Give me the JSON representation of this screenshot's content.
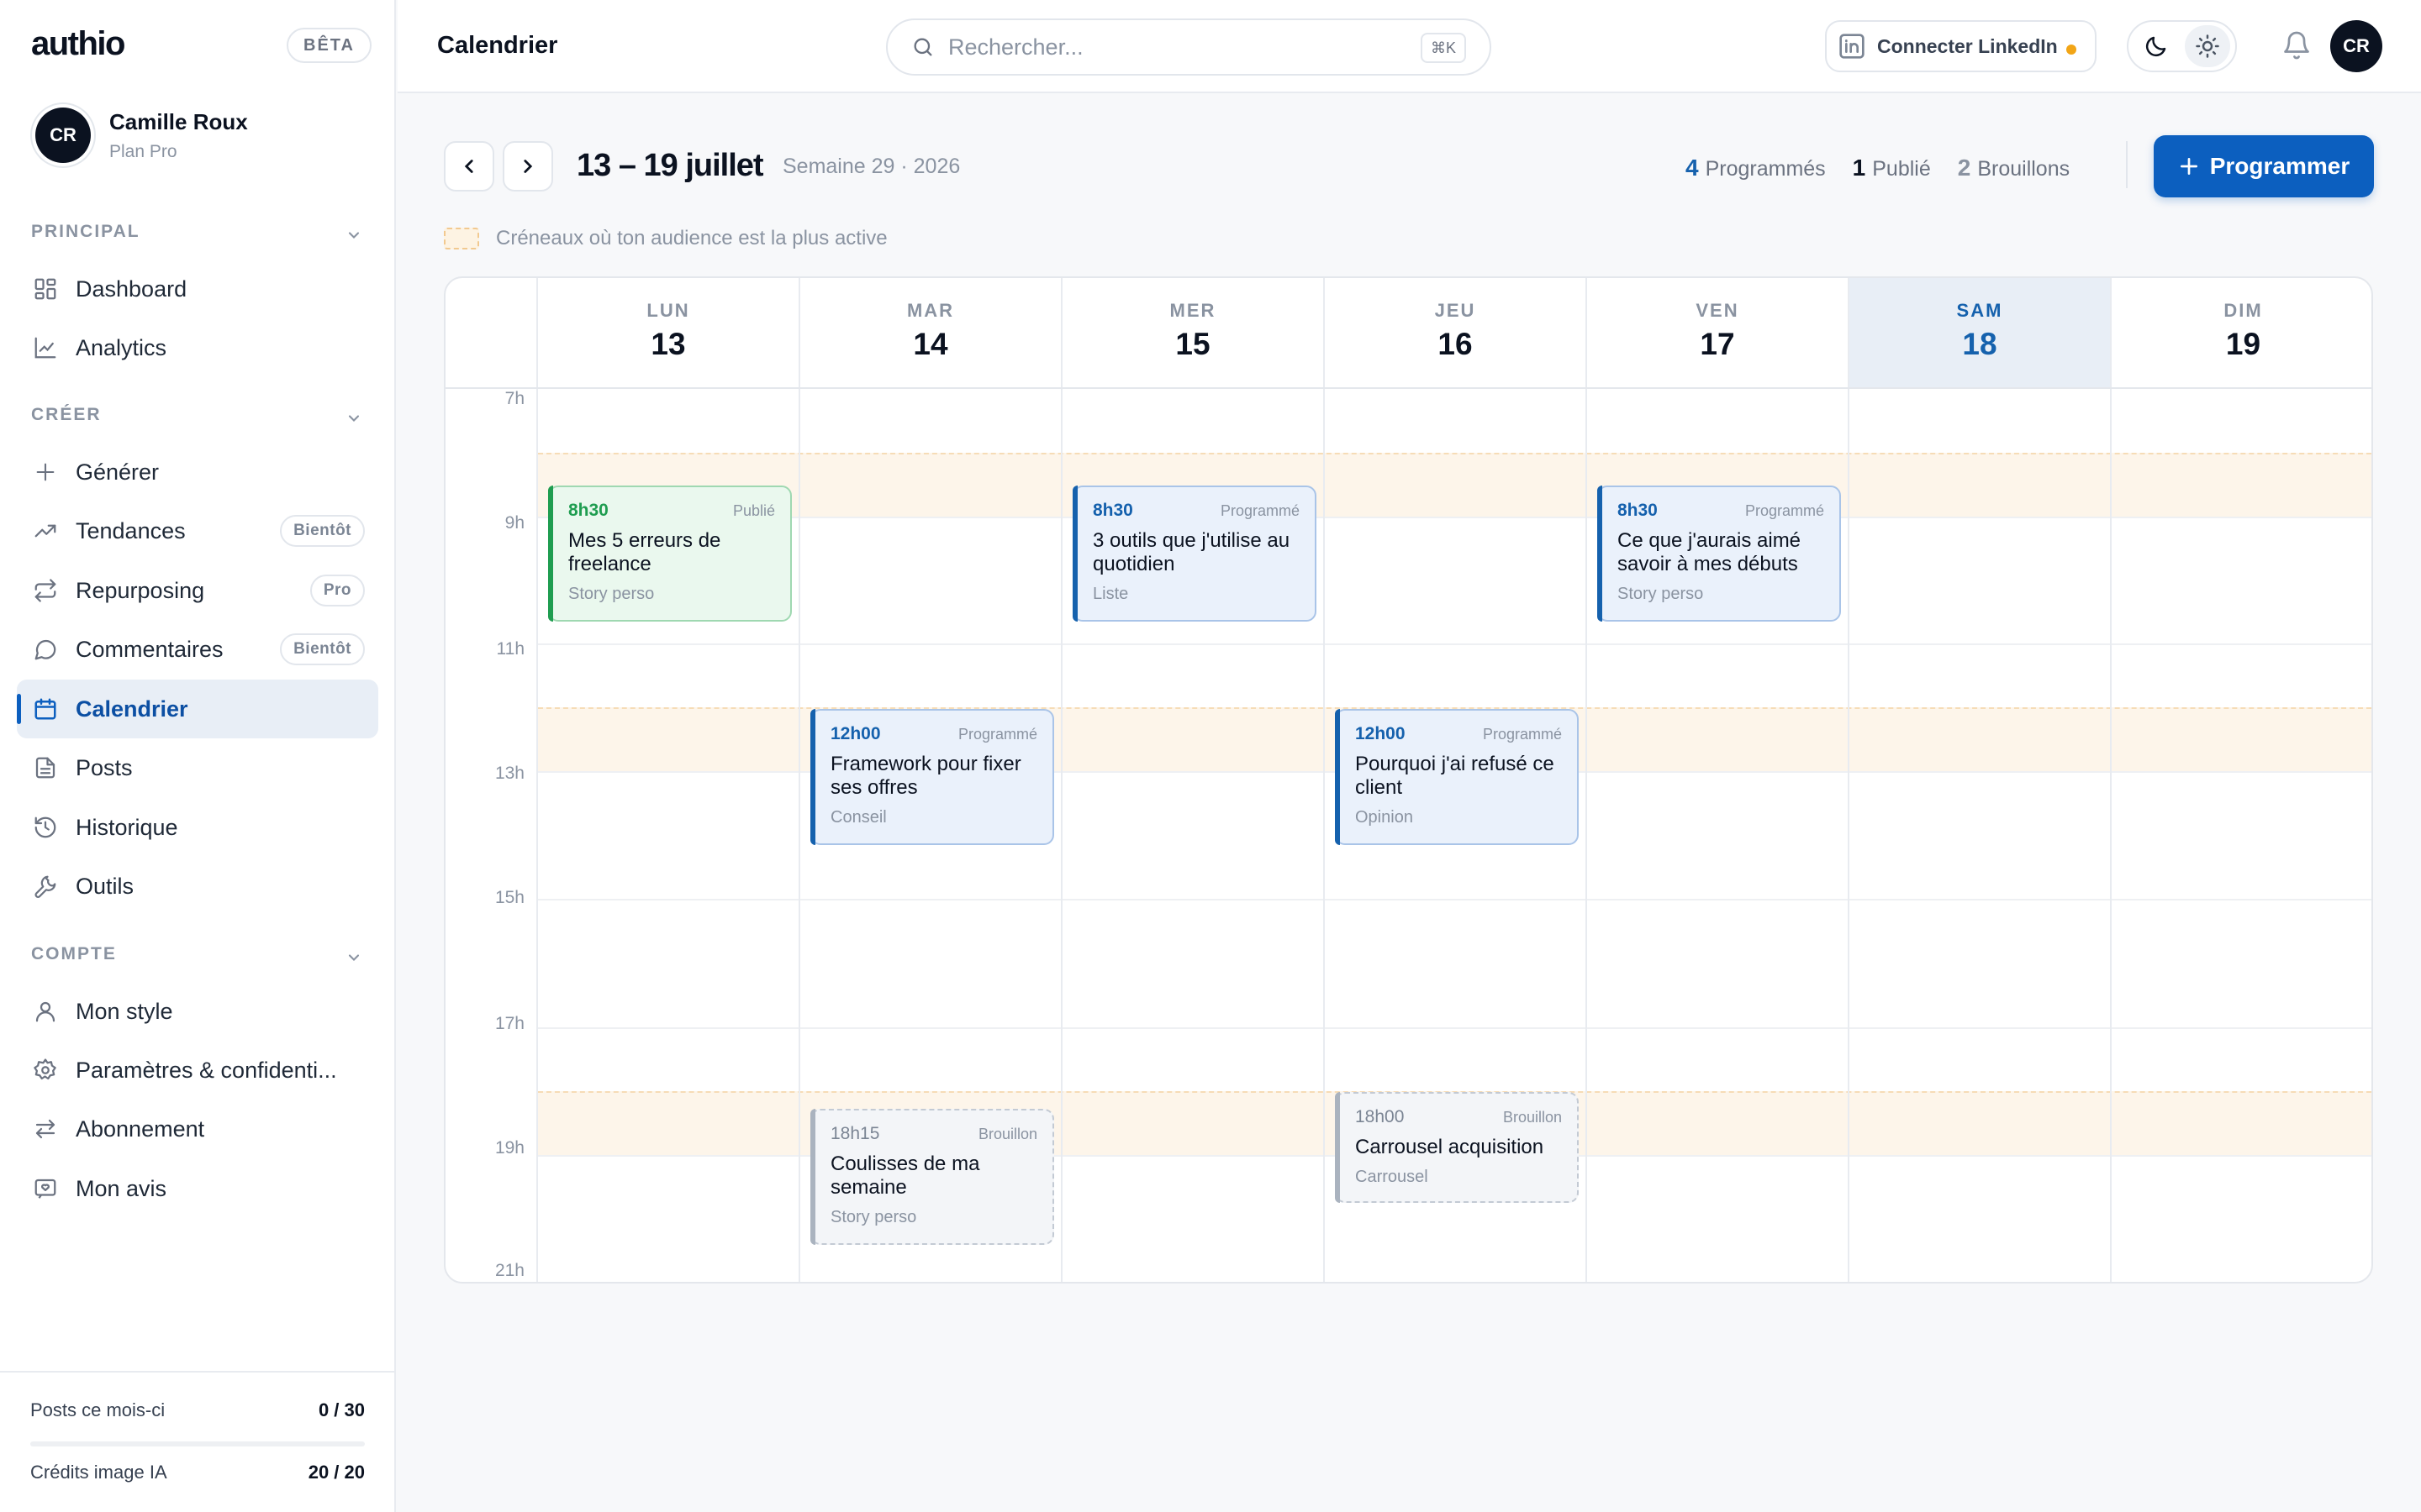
{
  "app": {
    "logo": "authio",
    "badge": "BÊTA"
  },
  "user": {
    "initials": "CR",
    "name": "Camille Roux",
    "plan": "Plan Pro"
  },
  "sidebar": {
    "sections": [
      {
        "title": "PRINCIPAL"
      },
      {
        "title": "CRÉER"
      },
      {
        "title": "COMPTE"
      }
    ],
    "items": [
      {
        "label": "Dashboard",
        "icon": "grid-icon"
      },
      {
        "label": "Analytics",
        "icon": "chart-icon"
      },
      {
        "label": "Générer",
        "icon": "plus-icon"
      },
      {
        "label": "Tendances",
        "icon": "trending-icon",
        "badge": "Bientôt"
      },
      {
        "label": "Repurposing",
        "icon": "repeat-icon",
        "badge": "Pro"
      },
      {
        "label": "Commentaires",
        "icon": "comment-icon",
        "badge": "Bientôt"
      },
      {
        "label": "Calendrier",
        "icon": "calendar-icon",
        "active": true
      },
      {
        "label": "Posts",
        "icon": "file-icon"
      },
      {
        "label": "Historique",
        "icon": "history-icon"
      },
      {
        "label": "Outils",
        "icon": "wrench-icon"
      },
      {
        "label": "Mon style",
        "icon": "user-icon"
      },
      {
        "label": "Paramètres & confidenti...",
        "icon": "gear-icon"
      },
      {
        "label": "Abonnement",
        "icon": "swap-icon"
      },
      {
        "label": "Mon avis",
        "icon": "feedback-icon"
      }
    ],
    "quotas": [
      {
        "label": "Posts ce mois-ci",
        "value": "0 / 30",
        "fill": 0
      },
      {
        "label": "Crédits image IA",
        "value": "20 / 20",
        "fill": 1
      }
    ]
  },
  "topbar": {
    "title": "Calendrier",
    "search_placeholder": "Rechercher...",
    "search_shortcut": "⌘K",
    "linkedin_label": "Connecter LinkedIn",
    "avatar_initials": "CR"
  },
  "calendar": {
    "range": "13 – 19 juillet",
    "week": "Semaine 29 · 2026",
    "stats": [
      {
        "count": "4",
        "label": "Programmés",
        "color": "#1561ad"
      },
      {
        "count": "1",
        "label": "Publié",
        "color": "#0b1220"
      },
      {
        "count": "2",
        "label": "Brouillons",
        "color": "#8a93a1"
      }
    ],
    "program_label": "Programmer",
    "legend": "Créneaux où ton audience est la plus active",
    "days": [
      {
        "name": "LUN",
        "date": "13"
      },
      {
        "name": "MAR",
        "date": "14"
      },
      {
        "name": "MER",
        "date": "15"
      },
      {
        "name": "JEU",
        "date": "16"
      },
      {
        "name": "VEN",
        "date": "17"
      },
      {
        "name": "SAM",
        "date": "18",
        "today": true
      },
      {
        "name": "DIM",
        "date": "19"
      }
    ],
    "hours": [
      "7h",
      "9h",
      "11h",
      "13h",
      "15h",
      "17h",
      "19h",
      "21h"
    ],
    "events": [
      {
        "time": "8h30",
        "status": "Publié",
        "title": "Mes 5 erreurs de freelance",
        "tag": "Story perso",
        "type": "published"
      },
      {
        "time": "8h30",
        "status": "Programmé",
        "title": "3 outils que j'utilise au quotidien",
        "tag": "Liste",
        "type": "scheduled"
      },
      {
        "time": "8h30",
        "status": "Programmé",
        "title": "Ce que j'aurais aimé savoir à mes débuts",
        "tag": "Story perso",
        "type": "scheduled"
      },
      {
        "time": "12h00",
        "status": "Programmé",
        "title": "Framework pour fixer ses offres",
        "tag": "Conseil",
        "type": "scheduled"
      },
      {
        "time": "12h00",
        "status": "Programmé",
        "title": "Pourquoi j'ai refusé ce client",
        "tag": "Opinion",
        "type": "scheduled"
      },
      {
        "time": "18h15",
        "status": "Brouillon",
        "title": "Coulisses de ma semaine",
        "tag": "Story perso",
        "type": "draft"
      },
      {
        "time": "18h00",
        "status": "Brouillon",
        "title": "Carrousel acquisition",
        "tag": "Carrousel",
        "type": "draft"
      }
    ]
  }
}
